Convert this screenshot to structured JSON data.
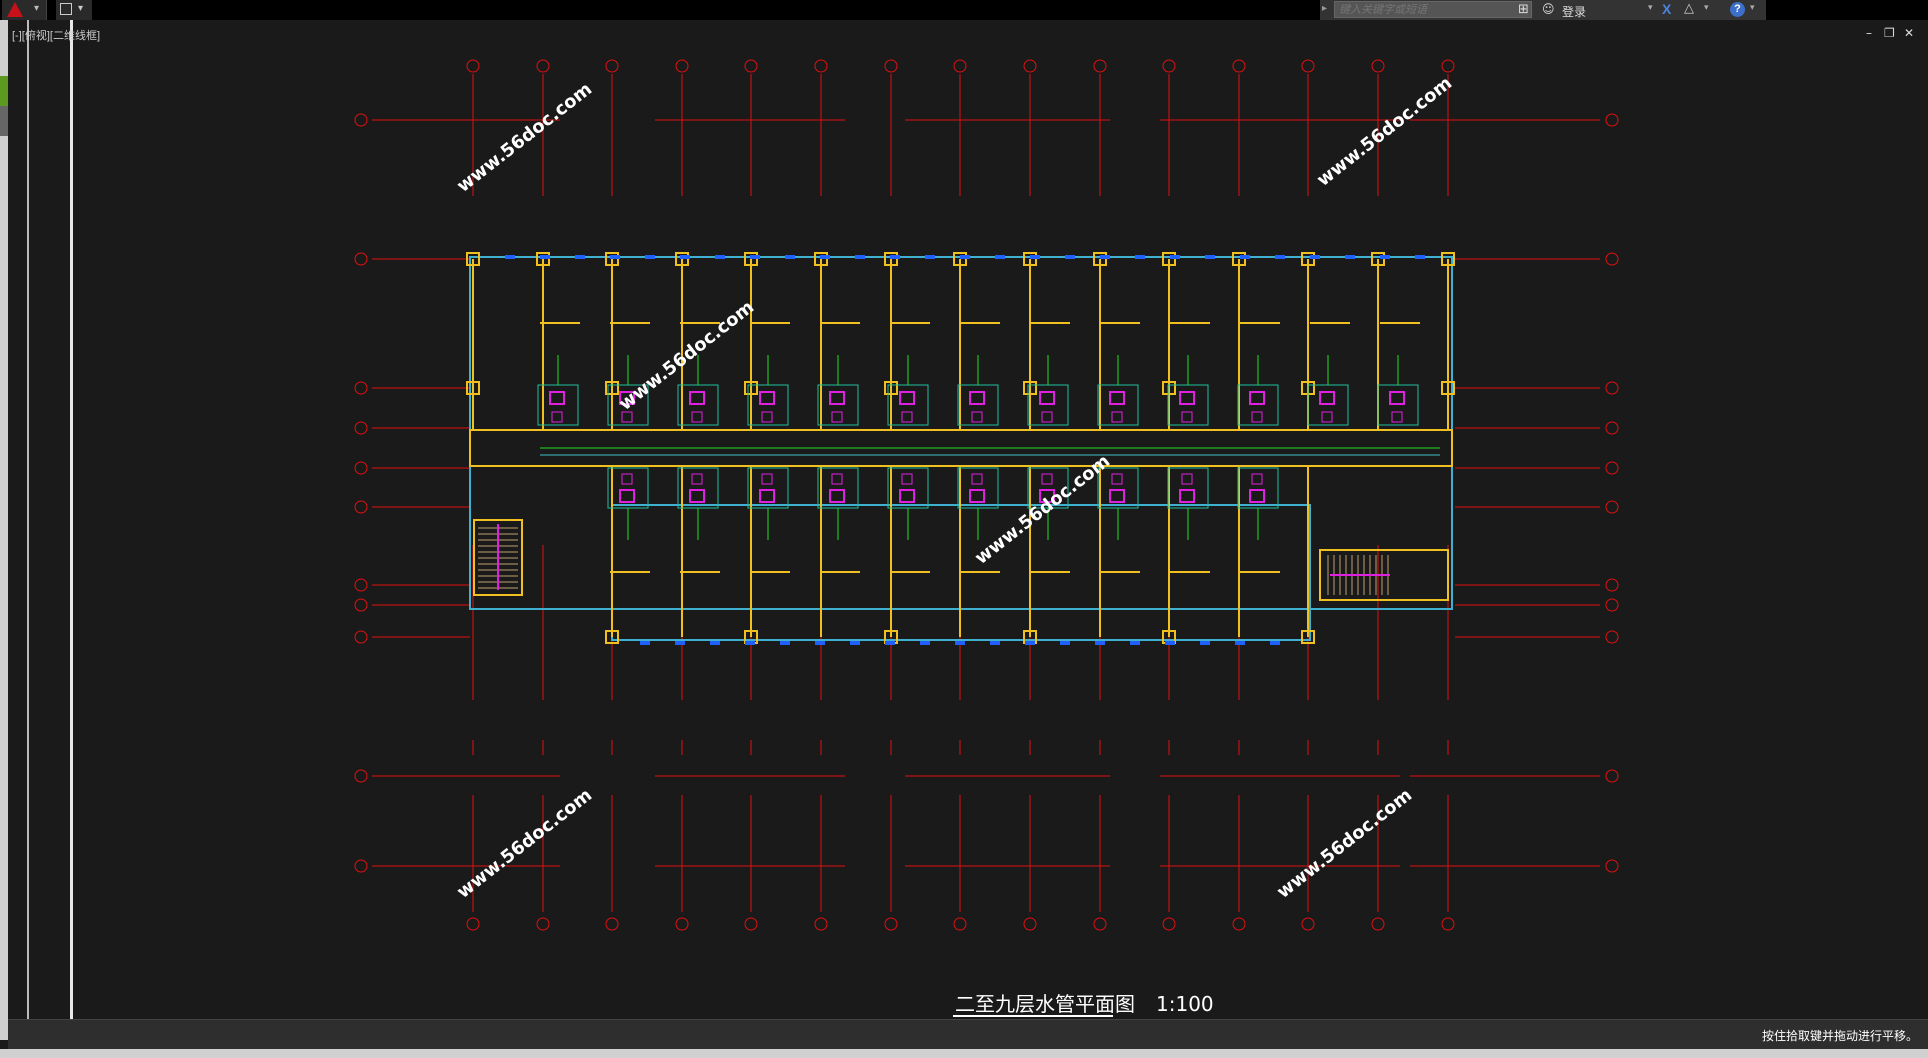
{
  "app": {
    "logo_icon": "autocad-logo-icon",
    "quick_access_icon": "save-icon"
  },
  "infocenter": {
    "search_placeholder": "键入关键字或短语",
    "login_label": "登录",
    "help_label": "?"
  },
  "viewport": {
    "label": "[-][俯视][二维线框]",
    "minimize": "–",
    "restore": "❐",
    "close": "✕"
  },
  "drawing": {
    "title": "二至九层水管平面图",
    "scale": "1:100",
    "watermark": "www.56doc.com",
    "colors": {
      "axis": "#e01010",
      "wall": "#f0c020",
      "pipe": "#20e020",
      "fixture": "#e020e0",
      "window": "#2060ff",
      "background": "#1a1a1a"
    }
  },
  "status": {
    "prompt": "按住拾取键并拖动进行平移。"
  }
}
